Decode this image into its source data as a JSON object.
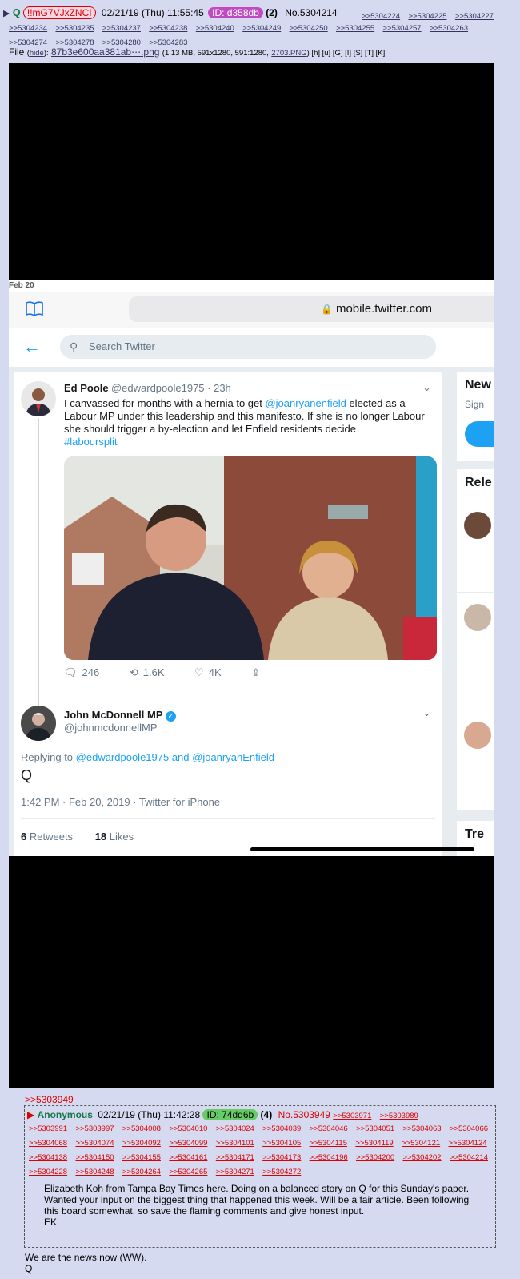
{
  "post": {
    "arrow": "▶",
    "name": "Q",
    "tripcode": "!!mG7VJxZNCI",
    "datetime": "02/21/19 (Thu) 11:55:45",
    "id": "ID: d358db",
    "id_count": "(2)",
    "post_no": "No.5304214",
    "backlinks_first": [
      ">>5304224",
      ">>5304225",
      ">>5304227"
    ],
    "backlinks": [
      ">>5304234",
      ">>5304235",
      ">>5304237",
      ">>5304238",
      ">>5304240",
      ">>5304249",
      ">>5304250",
      ">>5304255",
      ">>5304257",
      ">>5304263",
      ">>5304274",
      ">>5304278",
      ">>5304280",
      ">>5304283"
    ],
    "file_label": "File",
    "hide": "hide",
    "file_name": "87b3e600aa381ab⋯.png",
    "file_info": "(1.13 MB, 591x1280, 591:1280,",
    "file_orig": "2703.PNG",
    "file_tail": ") [h] [u] [G] [I] [S] [T] [K]"
  },
  "screenshot": {
    "date_header": "Feb 20",
    "url": "mobile.twitter.com",
    "search_placeholder": "Search Twitter",
    "tweet1": {
      "name": "Ed Poole",
      "handle": "@edwardpoole1975 · 23h",
      "text_before": "I canvassed for months with a hernia to get ",
      "mention": "@joanryanenfield",
      "text_after": " elected as a Labour MP under this leadership and this manifesto. If she is no longer Labour she should trigger a by-election and let Enfield residents decide",
      "hashtag": "#laboursplit",
      "replies": "246",
      "retweets": "1.6K",
      "likes": "4K"
    },
    "tweet2": {
      "name": "John McDonnell MP",
      "handle": "@johnmcdonnellMP",
      "replying_label": "Replying to ",
      "replying_to": "@edwardpoole1975 and @joanryanEnfield",
      "text": "Q",
      "meta": "1:42 PM · Feb 20, 2019 · Twitter for iPhone",
      "retweets_count": "6",
      "retweets_label": "Retweets",
      "likes_count": "18",
      "likes_label": "Likes"
    },
    "side": {
      "new_heading": "New",
      "sign": "Sign",
      "relevant_heading": "Rele",
      "trends_heading": "Tre"
    },
    "colors": {
      "twitter_blue": "#1da1f2",
      "verified": "#1da1f2"
    }
  },
  "reply": {
    "ref": ">>5303949",
    "name": "Anonymous",
    "datetime": "02/21/19 (Thu) 11:42:28",
    "id": "ID: 74dd6b",
    "id_count": "(4)",
    "post_no": "No.5303949",
    "header_backlinks": [
      ">>5303971",
      ">>5303989"
    ],
    "backlinks": [
      ">>5303991",
      ">>5303997",
      ">>5304008",
      ">>5304010",
      ">>5304024",
      ">>5304039",
      ">>5304046",
      ">>5304051",
      ">>5304063",
      ">>5304066",
      ">>5304068",
      ">>5304074",
      ">>5304092",
      ">>5304099",
      ">>5304101",
      ">>5304105",
      ">>5304115",
      ">>5304119",
      ">>5304121",
      ">>5304124",
      ">>5304138",
      ">>5304150",
      ">>5304155",
      ">>5304161",
      ">>5304171",
      ">>5304173",
      ">>5304196",
      ">>5304200",
      ">>5304202",
      ">>5304214",
      ">>5304228",
      ">>5304248",
      ">>5304264",
      ">>5304265",
      ">>5304271",
      ">>5304272"
    ],
    "body": "Elizabeth Koh from Tampa Bay Times here. Doing on a balanced story on Q for this Sunday's paper. Wanted your input on the biggest thing that happened this week. Will be a fair article. Been following this board somewhat, so save the flaming comments and give honest input.",
    "signature": "EK"
  },
  "closing": {
    "line1": "We are the news now (WW).",
    "line2": "Q"
  }
}
